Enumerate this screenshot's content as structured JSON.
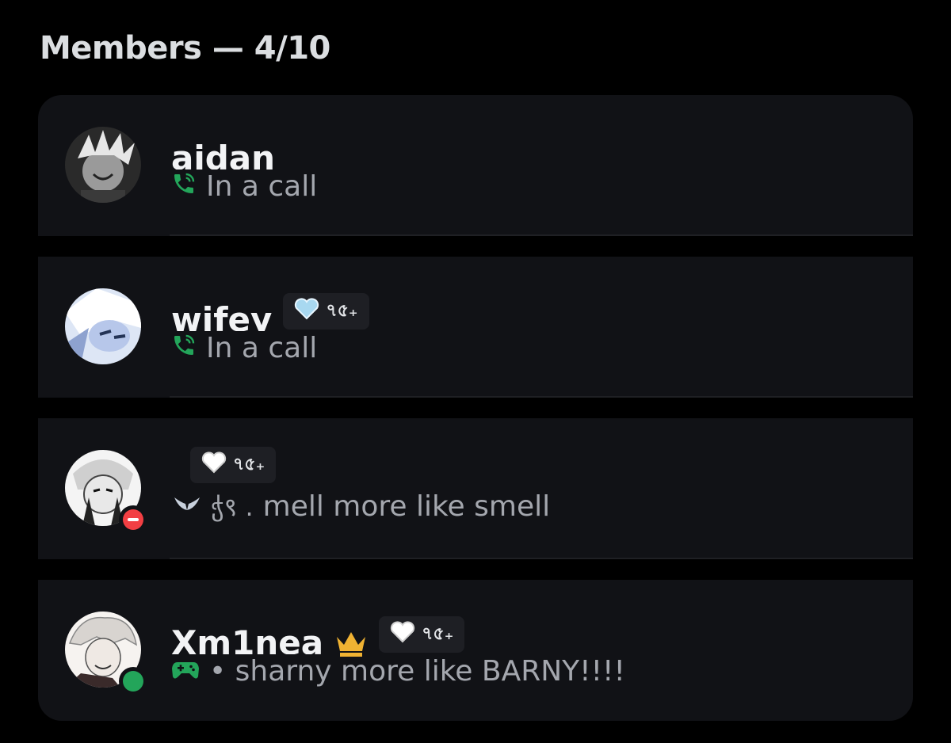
{
  "header": {
    "title": "Members — 4/10"
  },
  "members": [
    {
      "name": "aidan",
      "status_icon": "phone-call-icon",
      "status_text": "In a call"
    },
    {
      "name": "wifey",
      "tag_text": "৭৫₊",
      "tag_icon": "heart-icon",
      "status_icon": "phone-call-icon",
      "status_text": "In a call"
    },
    {
      "name": "",
      "tag_text": "৭৫₊",
      "tag_icon": "heart-icon",
      "presence": "do-not-disturb",
      "status_prefix": "ჭ९ .",
      "status_text": "mell more like smell"
    },
    {
      "name": "Xm1nea",
      "owner_icon": "crown-icon",
      "tag_text": "৭৫₊",
      "tag_icon": "heart-icon",
      "presence": "online",
      "status_icon": "gamepad-icon",
      "status_text": "• sharny more like BARNY!!!!"
    }
  ],
  "colors": {
    "background": "#000000",
    "card": "#111216",
    "call_green": "#23a55a",
    "dnd_red": "#f23f43",
    "crown_gold": "#f0b232"
  }
}
